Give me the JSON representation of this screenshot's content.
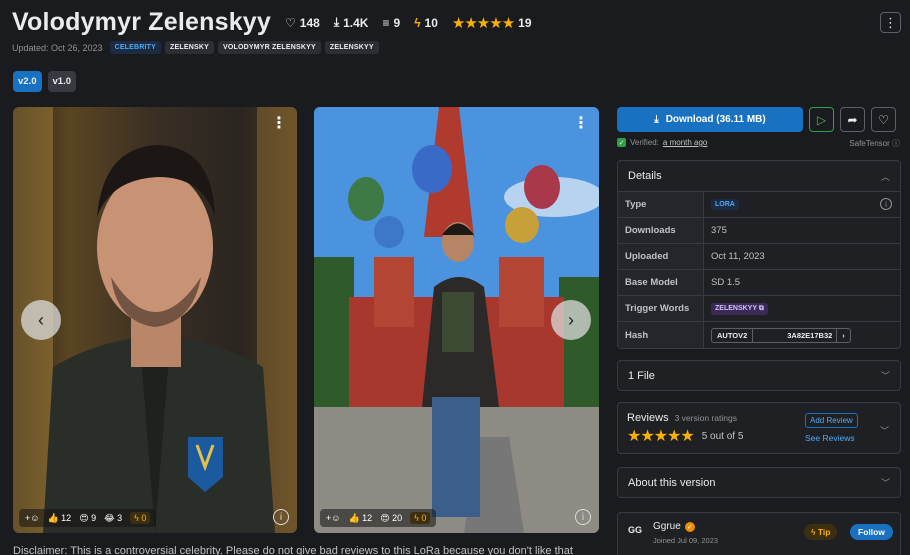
{
  "header": {
    "title": "Volodymyr Zelenskyy",
    "likes": "148",
    "downloads": "1.4K",
    "collects": "9",
    "buzz": "10",
    "rating_count": "19",
    "rating_stars": "★★★★★",
    "updated": "Updated: Oct 26, 2023",
    "tags": [
      "CELEBRITY",
      "ZELENSKY",
      "VOLODYMYR ZELENSKYY",
      "ZELENSKYY"
    ],
    "menu_icon": "⋮"
  },
  "versions": [
    "v2.0",
    "v1.0"
  ],
  "gallery": {
    "image1": {
      "reactions": [
        "12",
        "9",
        "3"
      ],
      "buzz": "0"
    },
    "image2": {
      "reactions": [
        "12",
        "20"
      ],
      "buzz": "0"
    }
  },
  "disclaimer": "Disclaimer: This is a controversial celebrity. Please do not give bad reviews to this LoRa because you don't like that",
  "download": {
    "label": "Download (36.11 MB)",
    "verified_prefix": "Verified:",
    "verified_when": "a month ago",
    "format": "SafeTensor"
  },
  "details": {
    "title": "Details",
    "rows": {
      "type": {
        "k": "Type",
        "v": "LORA"
      },
      "downloads": {
        "k": "Downloads",
        "v": "375"
      },
      "uploaded": {
        "k": "Uploaded",
        "v": "Oct 11, 2023"
      },
      "base_model": {
        "k": "Base Model",
        "v": "SD 1.5"
      },
      "trigger": {
        "k": "Trigger Words",
        "v": "ZELENSKYY"
      },
      "hash": {
        "k": "Hash",
        "alg": "AUTOV2",
        "v": "3A82E17B32"
      }
    }
  },
  "files": {
    "label": "1 File"
  },
  "reviews": {
    "title": "Reviews",
    "count": "3 version ratings",
    "stars": "★★★★★",
    "score": "5 out of 5",
    "add": "Add Review",
    "see": "See Reviews"
  },
  "about": {
    "label": "About this version"
  },
  "creator": {
    "initials": "GG",
    "name": "Ggrue",
    "joined": "Joined Jul 09, 2023",
    "tip": "Tip",
    "follow": "Follow"
  },
  "colors": {
    "accent": "#1971c2",
    "star": "#fab005",
    "bg": "#1a1b1e"
  }
}
